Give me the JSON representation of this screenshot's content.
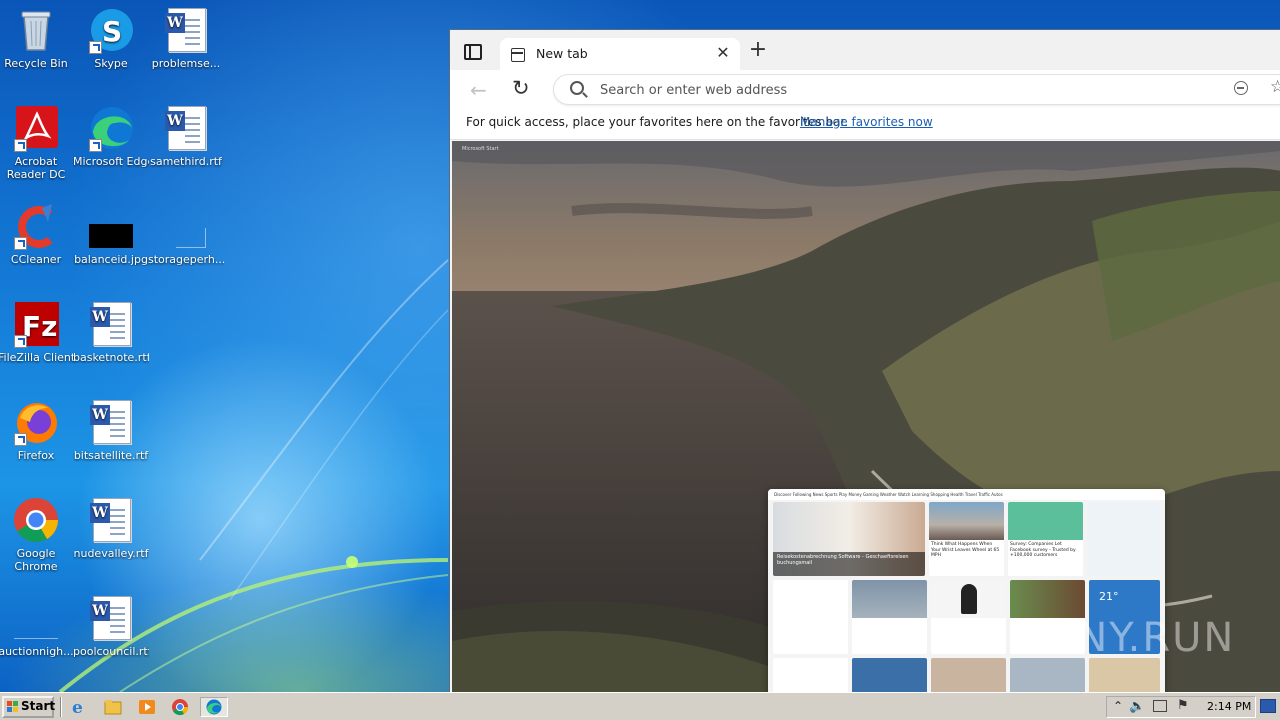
{
  "desktop": {
    "icons": [
      {
        "label": "Recycle Bin",
        "icon": "recycle-bin-icon"
      },
      {
        "label": "Skype",
        "icon": "skype-icon"
      },
      {
        "label": "problemse...",
        "icon": "word-document-icon"
      },
      {
        "label": "Acrobat Reader DC",
        "icon": "acrobat-reader-icon"
      },
      {
        "label": "Microsoft Edge",
        "icon": "edge-icon"
      },
      {
        "label": "samethird.rtf",
        "icon": "word-document-icon"
      },
      {
        "label": "CCleaner",
        "icon": "ccleaner-icon"
      },
      {
        "label": "balanceid.jpg",
        "icon": "image-file-icon"
      },
      {
        "label": "storageperh...",
        "icon": "blank-file-icon"
      },
      {
        "label": "FileZilla Client",
        "icon": "filezilla-icon"
      },
      {
        "label": "basketnote.rtf",
        "icon": "word-document-icon"
      },
      {
        "label": "Firefox",
        "icon": "firefox-icon"
      },
      {
        "label": "bitsatellite.rtf",
        "icon": "word-document-icon"
      },
      {
        "label": "Google Chrome",
        "icon": "chrome-icon"
      },
      {
        "label": "nudevalley.rtf",
        "icon": "word-document-icon"
      },
      {
        "label": "auctionnigh...",
        "icon": "blank-file-icon"
      },
      {
        "label": "poolcouncil.rtf",
        "icon": "word-document-icon"
      }
    ]
  },
  "browser": {
    "tab_title": "New tab",
    "tab_close": "✕",
    "new_tab": "+",
    "address_placeholder": "Search or enter web address",
    "favorites_message": "For quick access, place your favorites here on the favorites bar.",
    "favorites_link": "Manage favorites now",
    "ntp_brand": "Microsoft Start",
    "feed_nav": "Discover   Following   News   Sports   Play   Money   Gaming   Weather   Watch   Learning   Shopping   Health   Travel   Traffic   Autos",
    "feed_headline_1": "Reisekostenabrechnung Software - Geschaeftsreisen buchungsmail",
    "feed_headline_2": "Think What Happens When Your Wrist Leaves Wheel at 65 MPH",
    "feed_headline_3": "Survey: Companies Let Facebook survey - Trusted by +100,000 customers",
    "feed_weather": "21°"
  },
  "watermark": "ANY.RUN",
  "taskbar": {
    "start_label": "Start",
    "clock": "2:14 PM"
  },
  "colors": {
    "taskbar": "#d4d0c8",
    "link": "#1a5fb4",
    "wallpaper": "#1479d6"
  }
}
